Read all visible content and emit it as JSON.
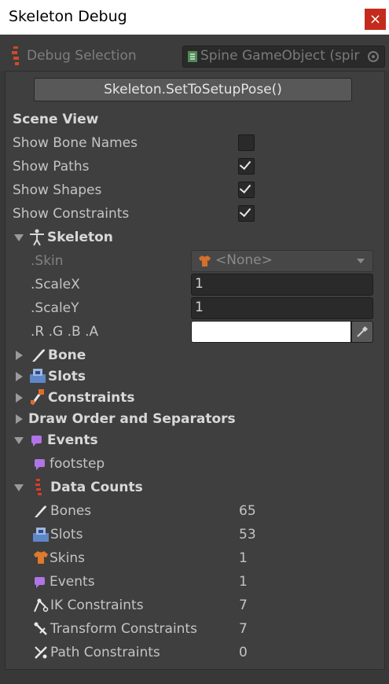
{
  "window": {
    "title": "Skeleton Debug",
    "close_glyph": "×"
  },
  "debug_selection": {
    "label": "Debug Selection",
    "object_field": "Spine GameObject (spir"
  },
  "buttons": {
    "set_to_setup_pose": "Skeleton.SetToSetupPose()"
  },
  "scene_view": {
    "heading": "Scene View",
    "toggles": [
      {
        "label": "Show Bone Names",
        "checked": false
      },
      {
        "label": "Show Paths",
        "checked": true
      },
      {
        "label": "Show Shapes",
        "checked": true
      },
      {
        "label": "Show Constraints",
        "checked": true
      }
    ]
  },
  "skeleton": {
    "heading": "Skeleton",
    "skin_label": ".Skin",
    "skin_value": "<None>",
    "scalex_label": ".ScaleX",
    "scalex_value": "1",
    "scaley_label": ".ScaleY",
    "scaley_value": "1",
    "rgba_label": ".R .G .B .A",
    "color": "#ffffff"
  },
  "sections": {
    "bone": "Bone",
    "slots": "Slots",
    "constraints": "Constraints",
    "draw_order": "Draw Order and Separators",
    "events": "Events",
    "data_counts": "Data Counts"
  },
  "events": {
    "items": [
      "footstep"
    ]
  },
  "data_counts": [
    {
      "label": "Bones",
      "value": "65"
    },
    {
      "label": "Slots",
      "value": "53"
    },
    {
      "label": "Skins",
      "value": "1"
    },
    {
      "label": "Events",
      "value": "1"
    },
    {
      "label": "IK Constraints",
      "value": "7"
    },
    {
      "label": "Transform Constraints",
      "value": "7"
    },
    {
      "label": "Path Constraints",
      "value": "0"
    }
  ],
  "colors": {
    "event_purple": "#b074e6",
    "bone_white": "#e8e8e8",
    "close_red": "#c42b1c",
    "orange": "#e06a2c"
  }
}
